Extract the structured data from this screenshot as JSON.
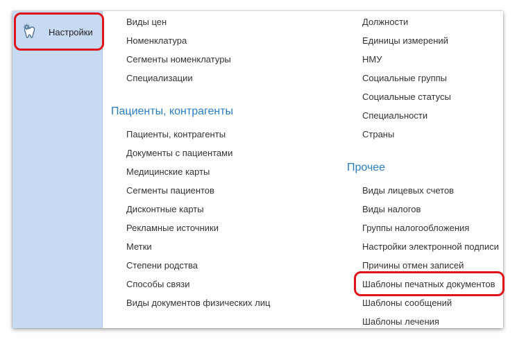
{
  "sidebar": {
    "items": [
      {
        "label": "Настройки",
        "icon": "tooth-gear-icon"
      }
    ]
  },
  "column1": {
    "top_links": [
      "Виды цен",
      "Номенклатура",
      "Сегменты номенклатуры",
      "Специализации"
    ],
    "section_title": "Пациенты, контрагенты",
    "section_links": [
      "Пациенты, контрагенты",
      "Документы с пациентами",
      "Медицинские карты",
      "Сегменты пациентов",
      "Дисконтные карты",
      "Рекламные источники",
      "Метки",
      "Степени родства",
      "Способы связи",
      "Виды документов физических лиц"
    ]
  },
  "column2": {
    "top_links": [
      "Должности",
      "Единицы измерений",
      "НМУ",
      "Социальные группы",
      "Социальные статусы",
      "Специальности",
      "Страны"
    ],
    "section_title": "Прочее",
    "section_links": [
      "Виды лицевых счетов",
      "Виды налогов",
      "Группы налогообложения",
      "Настройки электронной подписи",
      "Причины отмен записей",
      "Шаблоны печатных документов",
      "Шаблоны сообщений",
      "Шаблоны лечения"
    ]
  },
  "colors": {
    "sidebar_bg": "#c6dbf3",
    "section_title": "#2a7ec2",
    "highlight": "#e0121a",
    "link": "#333333"
  }
}
